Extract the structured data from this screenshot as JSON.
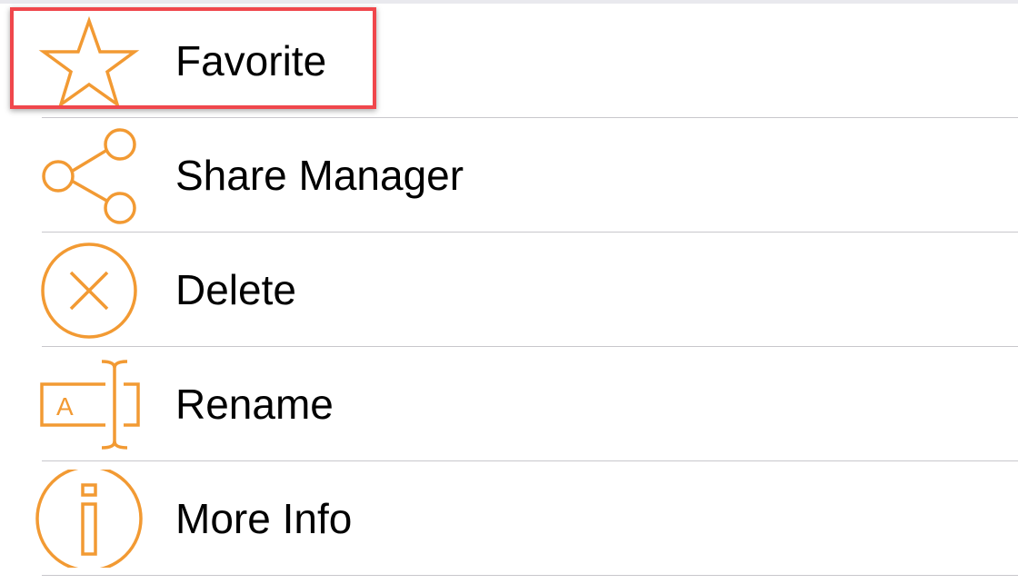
{
  "accent_color": "#f29a33",
  "highlight_color": "#f0474c",
  "menu": {
    "items": [
      {
        "label": "Favorite",
        "icon": "star-icon"
      },
      {
        "label": "Share Manager",
        "icon": "share-icon"
      },
      {
        "label": "Delete",
        "icon": "delete-circle-x-icon"
      },
      {
        "label": "Rename",
        "icon": "rename-text-cursor-icon"
      },
      {
        "label": "More Info",
        "icon": "info-icon"
      }
    ],
    "highlighted_item": "Favorite"
  }
}
